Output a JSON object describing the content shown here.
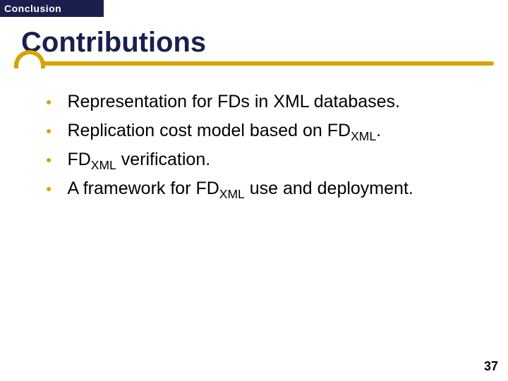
{
  "section_tag": "Conclusion",
  "title": "Contributions",
  "bullets": [
    {
      "pre": "Representation for FDs in XML databases.",
      "sub": "",
      "post": ""
    },
    {
      "pre": "Replication cost model based on FD",
      "sub": "XML",
      "post": "."
    },
    {
      "pre": "FD",
      "sub": "XML",
      "post": " verification."
    },
    {
      "pre": "A framework for FD",
      "sub": "XML",
      "post": " use and deployment."
    }
  ],
  "page_number": "37"
}
